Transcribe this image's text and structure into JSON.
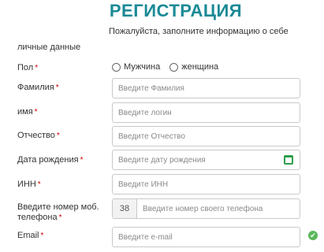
{
  "header": {
    "title": "РЕГИСТРАЦИЯ",
    "subtitle": "Пожалуйста, заполните информацию о себе"
  },
  "section_label": "личные данные",
  "fields": {
    "gender": {
      "label": "Пол",
      "required_mark": "*",
      "options": [
        "Мужчина",
        "женщина"
      ]
    },
    "last_name": {
      "label": "Фамилия",
      "required_mark": "*",
      "placeholder": "Введите Фамилия"
    },
    "first_name": {
      "label": "имя",
      "required_mark": "*",
      "placeholder": "Введите логин"
    },
    "patronymic": {
      "label": "Отчество",
      "required_mark": "*",
      "placeholder": "Введите Отчество"
    },
    "birth_date": {
      "label": "Дата рождения",
      "required_mark": "*",
      "placeholder": "Введите дату рождения"
    },
    "inn": {
      "label": "ИНН",
      "required_mark": "*",
      "placeholder": "Введите ИНН"
    },
    "phone": {
      "label_line1": "Введите номер моб.",
      "label_line2": "телефона",
      "required_mark": "*",
      "prefix": "38",
      "placeholder": "Введите номер своего телефона"
    },
    "email": {
      "label": "Email",
      "required_mark": "*",
      "placeholder": "Введите e-mail"
    }
  },
  "colors": {
    "title": "#1a8a96",
    "required": "#cc0000",
    "calendar_icon": "#2e9e4a",
    "check_icon": "#5cb85c"
  },
  "icons": {
    "calendar": "calendar-icon",
    "valid": "check-circle-icon"
  }
}
